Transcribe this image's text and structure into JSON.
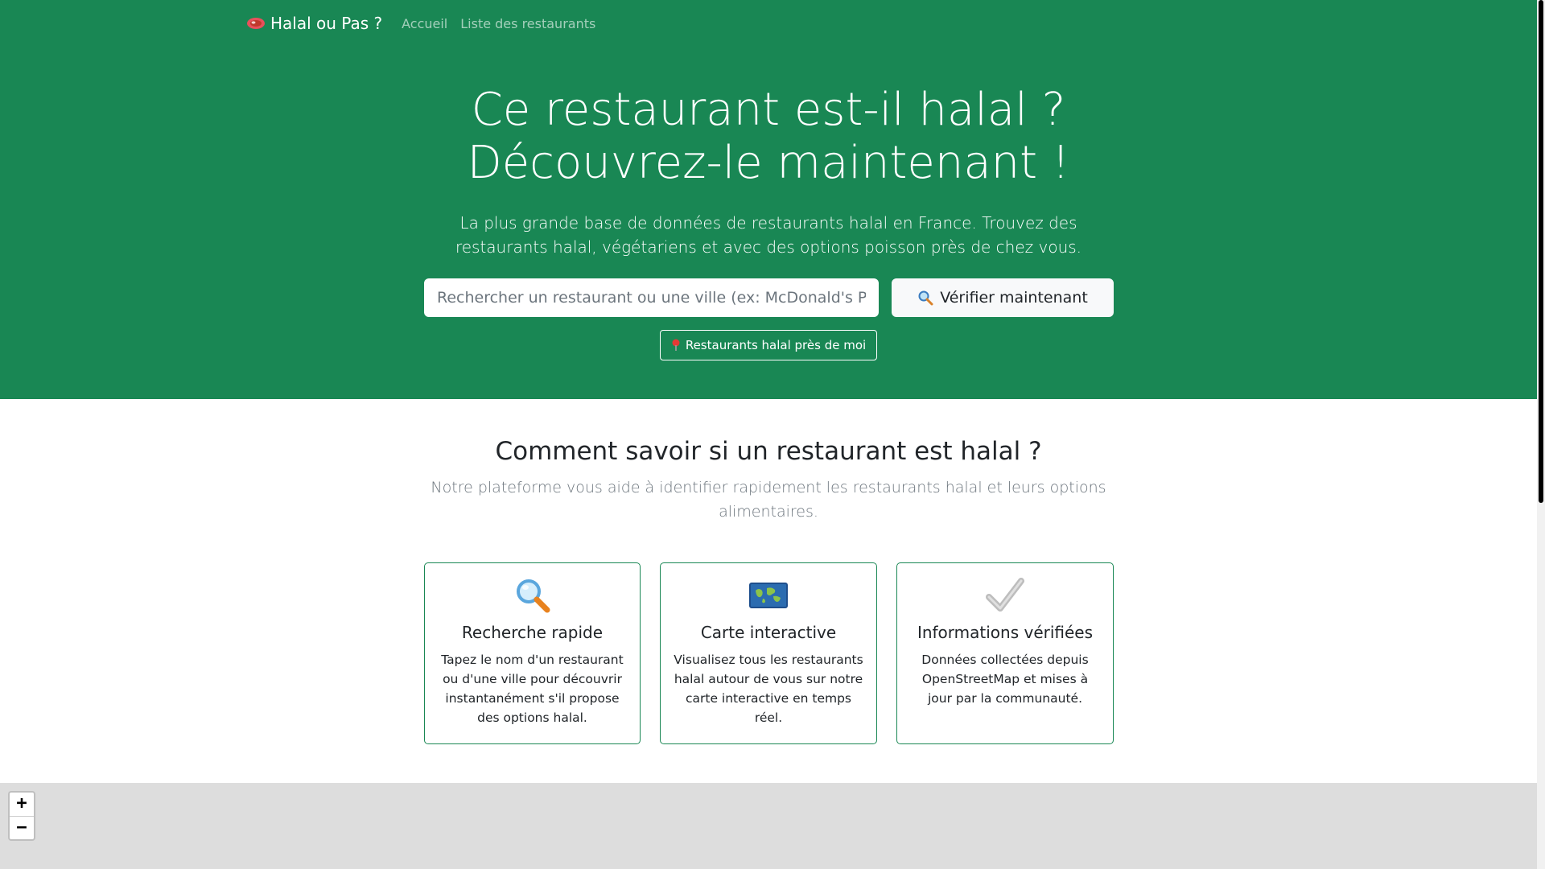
{
  "nav": {
    "brand": "Halal ou Pas ?",
    "links": [
      "Accueil",
      "Liste des restaurants"
    ]
  },
  "hero": {
    "title_line1": "Ce restaurant est-il halal ?",
    "title_line2": "Découvrez-le maintenant !",
    "subtitle": "La plus grande base de données de restaurants halal en France. Trouvez des restaurants halal, végétariens et avec des options poisson près de chez vous.",
    "search_placeholder": "Rechercher un restaurant ou une ville (ex: McDonald's Paris)",
    "verify_button": "Vérifier maintenant",
    "nearby_button": "Restaurants halal près de moi"
  },
  "features": {
    "title": "Comment savoir si un restaurant est halal ?",
    "subtitle": "Notre plateforme vous aide à identifier rapidement les restaurants halal et leurs options alimentaires.",
    "cards": [
      {
        "icon": "magnifier-icon",
        "title": "Recherche rapide",
        "text": "Tapez le nom d'un restaurant ou d'une ville pour découvrir instantanément s'il propose des options halal."
      },
      {
        "icon": "world-map-icon",
        "title": "Carte interactive",
        "text": "Visualisez tous les restaurants halal autour de vous sur notre carte interactive en temps réel."
      },
      {
        "icon": "check-mark-icon",
        "title": "Informations vérifiées",
        "text": "Données collectées depuis OpenStreetMap et mises à jour par la communauté."
      }
    ]
  },
  "map": {
    "zoom_in": "+",
    "zoom_out": "−"
  },
  "colors": {
    "brand_green": "#198754",
    "map_bg": "#dddddd"
  }
}
